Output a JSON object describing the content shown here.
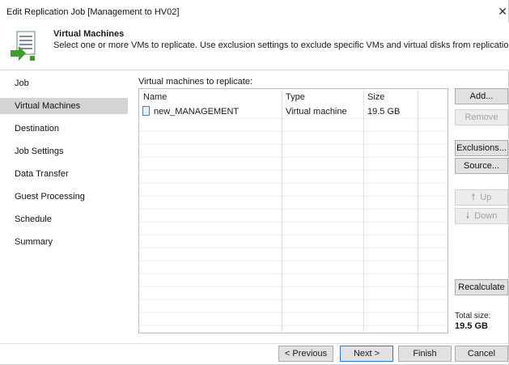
{
  "window": {
    "title": "Edit Replication Job [Management to HV02]",
    "close_glyph": "✕"
  },
  "header": {
    "title": "Virtual Machines",
    "description": "Select one or more VMs to replicate. Use exclusion settings to exclude specific VMs and virtual disks from replication.",
    "icon": "wizard-page-icon"
  },
  "sidebar": {
    "items": [
      {
        "label": "Job",
        "active": false
      },
      {
        "label": "Virtual Machines",
        "active": true
      },
      {
        "label": "Destination",
        "active": false
      },
      {
        "label": "Job Settings",
        "active": false
      },
      {
        "label": "Data Transfer",
        "active": false
      },
      {
        "label": "Guest Processing",
        "active": false
      },
      {
        "label": "Schedule",
        "active": false
      },
      {
        "label": "Summary",
        "active": false
      }
    ]
  },
  "vm_list": {
    "label": "Virtual machines to replicate:",
    "columns": [
      "Name",
      "Type",
      "Size"
    ],
    "rows": [
      {
        "name": "new_MANAGEMENT",
        "type": "Virtual machine",
        "size": "19.5 GB",
        "icon": "vm-icon"
      }
    ]
  },
  "actions": {
    "add": "Add...",
    "remove": "Remove",
    "exclusions": "Exclusions...",
    "source": "Source...",
    "up": "Up",
    "down": "Down",
    "recalculate": "Recalculate",
    "up_glyph": "🠕",
    "down_glyph": "🠗"
  },
  "total": {
    "label": "Total size:",
    "value": "19.5 GB"
  },
  "footer": {
    "previous": "< Previous",
    "next": "Next >",
    "finish": "Finish",
    "cancel": "Cancel"
  },
  "colors": {
    "active_nav": "#d4d4d4",
    "primary_button_border": "#2a7ad2"
  }
}
